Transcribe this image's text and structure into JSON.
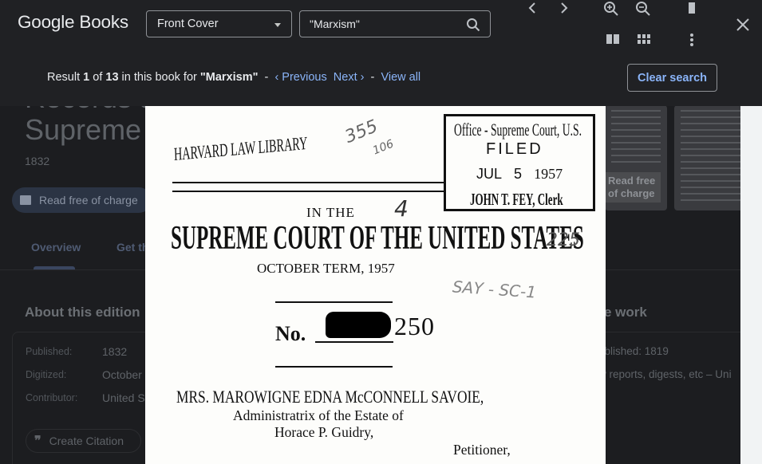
{
  "app": {
    "logo": "Google Books"
  },
  "toolbar": {
    "view_select": "Front Cover",
    "search_value": "\"Marxism\"",
    "icons": [
      "chevron-left-icon",
      "chevron-right-icon",
      "zoom-in-icon",
      "zoom-out-icon",
      "single-page-icon",
      "two-page-icon",
      "grid-view-icon",
      "more-vert-icon",
      "close-icon",
      "search-icon"
    ]
  },
  "results": {
    "prefix": "Result",
    "current": "1",
    "of": "of",
    "total": "13",
    "in_book_for": "in this book for",
    "term": "\"Marxism\"",
    "sep": "-",
    "previous": "‹ Previous",
    "next": "Next ›",
    "view_all": "View all",
    "clear": "Clear search"
  },
  "page_text": {
    "library": "HARVARD LAW LIBRARY",
    "hand_top": "355",
    "hand_top2": "106",
    "stamp_office": "Office - Supreme Court, U.S.",
    "stamp_filed": "FILED",
    "stamp_date_m": "JUL",
    "stamp_date_d": "5",
    "stamp_date_y": "1957",
    "stamp_clerk": "JOHN T. FEY, Clerk",
    "in_the": "IN THE",
    "court": "SUPREME COURT OF THE UNITED STATES",
    "hand_4": "4",
    "hand_225": "225",
    "term": "OCTOBER TERM, 1957",
    "hand_say": "SAY - SC-1",
    "no": "No.",
    "number": "250",
    "party1": "MRS. MAROWIGNE EDNA McCONNELL SAVOIE,",
    "party2": "Administratrix of the Estate of",
    "party3": "Horace P. Guidry,",
    "petitioner": "Petitioner,"
  },
  "background": {
    "title_line1": "Records a",
    "title_line2": "Supreme C",
    "year": "1832",
    "read_free": "Read free of charge",
    "tab_overview": "Overview",
    "tab_get": "Get th",
    "about": "About this edition",
    "work": "e work",
    "published_label": "Published:",
    "published_value": "1832",
    "digitized_label": "Digitized:",
    "digitized_value": "October",
    "contributor_label": "Contributor:",
    "contributor_value": "United St",
    "published_right": "ublished: 1819",
    "right_line": "w reports, digests, etc – Uni",
    "cite": "Create Citation",
    "thumb_read": "Read free of charge"
  }
}
